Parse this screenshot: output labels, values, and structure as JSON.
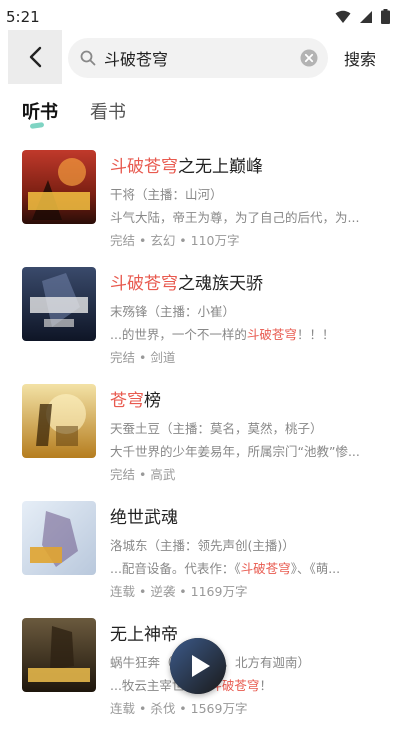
{
  "status_bar": {
    "time": "5:21"
  },
  "search": {
    "query": "斗破苍穹",
    "submit_label": "搜索"
  },
  "tabs": [
    {
      "label": "听书",
      "active": true
    },
    {
      "label": "看书",
      "active": false
    }
  ],
  "colors": {
    "highlight": "#e85a4f",
    "accent": "#7fd4c3"
  },
  "books": [
    {
      "title_hl": "斗破苍穹",
      "title_rest": "之无上巅峰",
      "author": "干将（主播：山河）",
      "desc_pre": "斗气大陆，帝王为尊，为了自己的后代，为...",
      "desc_hl": "",
      "desc_post": "",
      "meta": "完结 • 玄幻 • 110万字"
    },
    {
      "title_hl": "斗破苍穹",
      "title_rest": "之魂族天骄",
      "author": "末殇锋（主播：小崔）",
      "desc_pre": "...的世界，一个不一样的",
      "desc_hl": "斗破苍穹",
      "desc_post": "！！！",
      "meta": "完结 • 剑道"
    },
    {
      "title_hl": "苍穹",
      "title_rest": "榜",
      "author": "天蚕土豆（主播：莫名，莫然，桃子）",
      "desc_pre": "大千世界的少年姜易年，所属宗门“池教”惨...",
      "desc_hl": "",
      "desc_post": "",
      "meta": "完结 • 高武"
    },
    {
      "title_hl": "",
      "title_rest": "绝世武魂",
      "author": "洛城东（主播：领先声创(主播)）",
      "desc_pre": "...配音设备。代表作：《",
      "desc_hl": "斗破苍穹",
      "desc_post": "》、《萌...",
      "meta": "连载 • 逆袭 • 1169万字"
    },
    {
      "title_hl": "",
      "title_rest": "无上神帝",
      "author": "蜗牛狂奔（主播：远，北方有迦南）",
      "desc_pre": "...牧云主宰世界，",
      "desc_hl": "斗破苍穹",
      "desc_post": "！",
      "meta": "连载 • 杀伐 • 1569万字"
    }
  ],
  "icons": {
    "back": "back-arrow-icon",
    "search": "search-icon",
    "clear": "clear-icon",
    "play": "play-icon"
  }
}
